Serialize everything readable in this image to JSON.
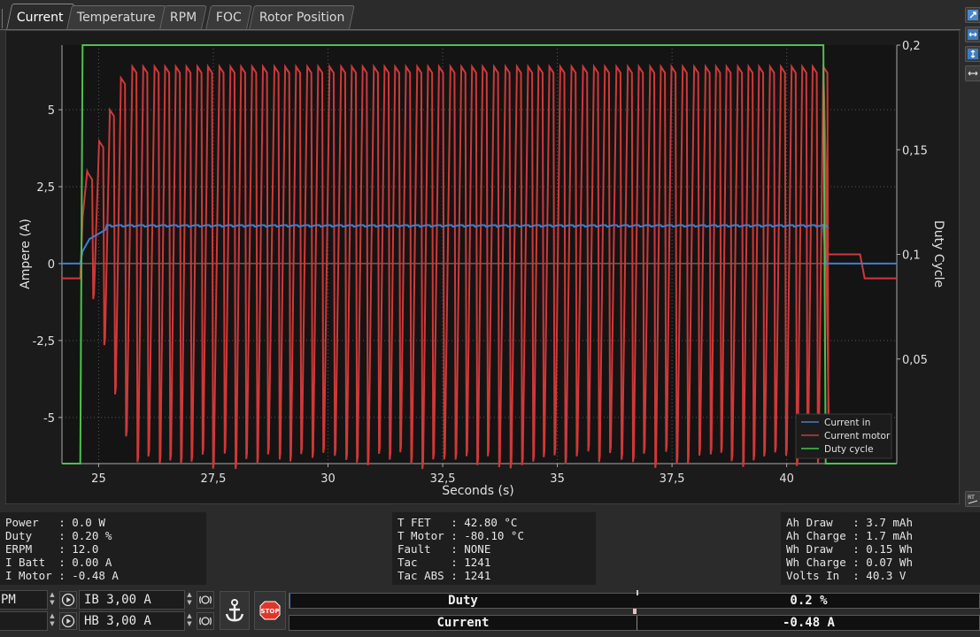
{
  "tabs": [
    {
      "label": "Current",
      "active": true
    },
    {
      "label": "Temperature",
      "active": false
    },
    {
      "label": "RPM",
      "active": false
    },
    {
      "label": "FOC",
      "active": false
    },
    {
      "label": "Rotor Position",
      "active": false
    }
  ],
  "right_toolbar": {
    "bottom_label": "RT"
  },
  "chart_data": {
    "type": "line",
    "xlabel": "Seconds (s)",
    "ylabel": "Ampere (A)",
    "y2label": "Duty Cycle",
    "xlim": [
      24.2,
      42.4
    ],
    "ylim": [
      -6.5,
      7.1
    ],
    "y2lim": [
      0.0,
      0.2
    ],
    "x_ticks": [
      "25",
      "27,5",
      "30",
      "32,5",
      "35",
      "37,5",
      "40"
    ],
    "y_ticks": [
      "5",
      "2,5",
      "0",
      "-2,5",
      "-5"
    ],
    "y2_ticks": [
      "0,2",
      "0,15",
      "0,1",
      "0,05"
    ],
    "grid": true,
    "legend_position": "bottom-right",
    "series": [
      {
        "name": "Current in",
        "color": "#3d7fd0",
        "description": "square-ish oscillation between about -1.3 and 1.3 A while duty active, 0 otherwise",
        "samples": [
          [
            24.2,
            0
          ],
          [
            24.6,
            0
          ],
          [
            24.7,
            0.7
          ],
          [
            25.0,
            1.2
          ],
          [
            40.8,
            1.2
          ],
          [
            40.85,
            0
          ],
          [
            42.4,
            0
          ]
        ]
      },
      {
        "name": "Current motor",
        "color": "#d03838",
        "description": "oscillates between about -6.4 and 6.4 A while duty active; -0.48 A at rest",
        "samples": [
          [
            24.2,
            -0.48
          ],
          [
            24.6,
            -0.48
          ],
          [
            24.7,
            3.0
          ],
          [
            25.0,
            6.0
          ],
          [
            26.0,
            6.3
          ],
          [
            40.7,
            6.4
          ],
          [
            40.9,
            0.3
          ],
          [
            41.6,
            0.3
          ],
          [
            41.7,
            -0.48
          ],
          [
            42.4,
            -0.48
          ]
        ]
      },
      {
        "name": "Duty cycle",
        "color": "#4fc04f",
        "axis": "right",
        "samples": [
          [
            24.2,
            0.0
          ],
          [
            24.6,
            0.0
          ],
          [
            24.65,
            0.2
          ],
          [
            40.8,
            0.2
          ],
          [
            40.85,
            0.0
          ],
          [
            42.4,
            0.0
          ]
        ]
      }
    ]
  },
  "stats": {
    "left": [
      "Power   : 0.0 W",
      "Duty    : 0.20 %",
      "ERPM    : 12.0",
      "I Batt  : 0.00 A",
      "I Motor : -0.48 A"
    ],
    "middle": [
      "T FET   : 42.80 °C",
      "T Motor : -80.10 °C",
      "Fault   : NONE",
      "Tac     : 1241",
      "Tac ABS : 1241"
    ],
    "right": [
      "Ah Draw   : 3.7 mAh",
      "Ah Charge : 1.7 mAh",
      "Wh Draw   : 0.15 Wh",
      "Wh Charge : 0.07 Wh",
      "Volts In  : 40.3 V"
    ]
  },
  "controls": {
    "rpm_partial": "PM",
    "ib_value": "IB 3,00 A",
    "hb_value": "HB 3,00 A",
    "stop_label": "STOP",
    "duty_label": "Duty",
    "duty_value": "0.2 %",
    "duty_fraction": 0.002,
    "current_label": "Current",
    "current_value": "-0.48 A"
  }
}
